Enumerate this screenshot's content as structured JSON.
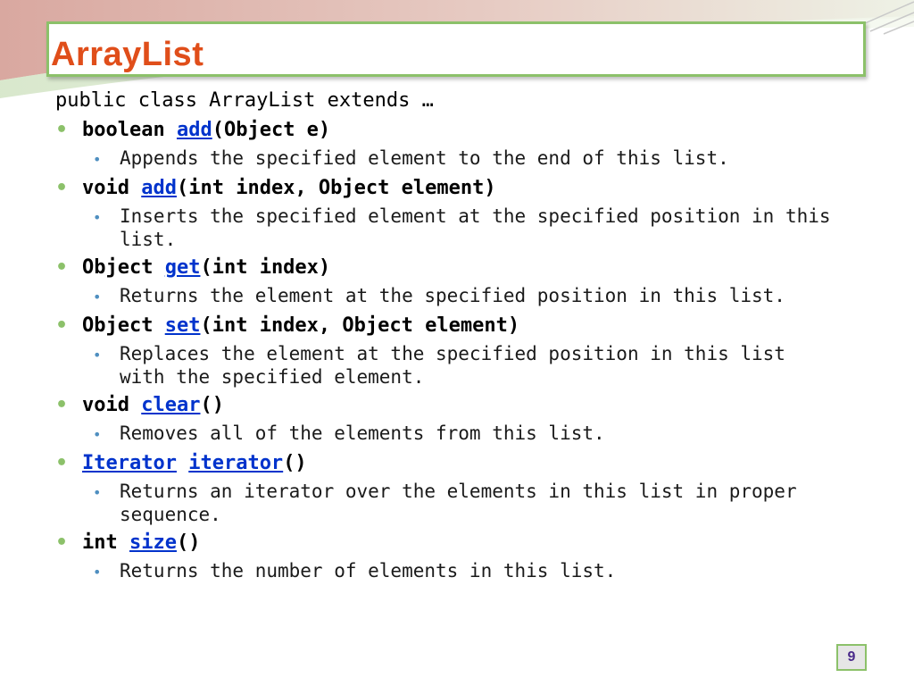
{
  "slide": {
    "title": "ArrayList",
    "intro": "public class ArrayList extends …",
    "page_number": "9"
  },
  "methods": [
    {
      "prefix": "boolean ",
      "link": "add",
      "suffix": "(Object e)",
      "description": "Appends the specified element to the end of this list."
    },
    {
      "prefix": "void ",
      "link": "add",
      "suffix": "(int index, Object element)",
      "description": "Inserts the specified element at the specified position in this list."
    },
    {
      "prefix": "Object ",
      "link": "get",
      "suffix": "(int index)",
      "description": "Returns the element at the specified position in this list."
    },
    {
      "prefix": "Object ",
      "link": "set",
      "suffix": "(int index, Object element)",
      "description": "Replaces the element at the specified position in this list with the specified element."
    },
    {
      "prefix": "void ",
      "link": "clear",
      "suffix": "()",
      "description": "Removes all of the elements from this list."
    },
    {
      "prefix": "",
      "link_type": "Iterator",
      "link": "iterator",
      "suffix": "()",
      "description": "Returns an iterator over the elements in this list in proper sequence."
    },
    {
      "prefix": "int ",
      "link": "size",
      "suffix": "()",
      "description": "Returns the number of elements in this list."
    }
  ],
  "colors": {
    "title": "#e04e1a",
    "accent_green": "#8cc16a",
    "link": "#0033cc",
    "sub_bullet": "#4f8fc0"
  }
}
